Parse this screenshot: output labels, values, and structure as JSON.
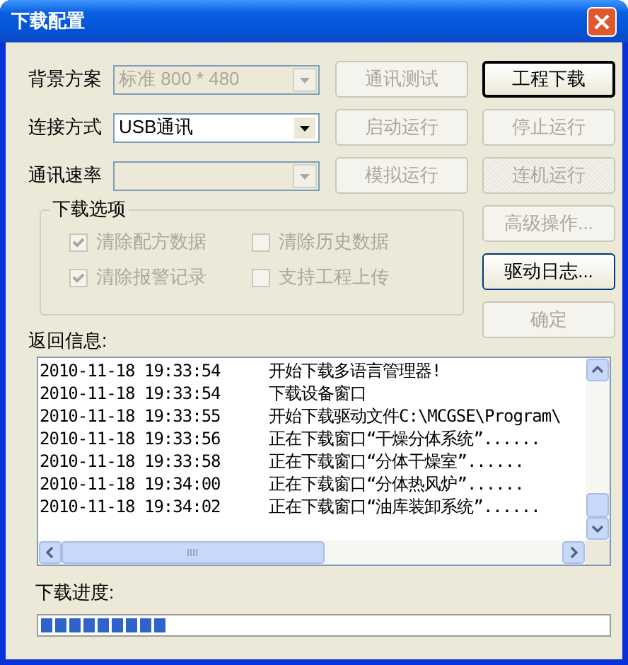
{
  "window": {
    "title": "下载配置"
  },
  "settings": [
    {
      "label": "背景方案",
      "value": "标准 800 * 480",
      "disabled": true
    },
    {
      "label": "连接方式",
      "value": "USB通讯",
      "disabled": false
    },
    {
      "label": "通讯速率",
      "disabled": true
    }
  ],
  "middle_buttons": [
    {
      "label": "通讯测试",
      "disabled": true
    },
    {
      "label": "启动运行",
      "disabled": true
    },
    {
      "label": "模拟运行",
      "disabled": true
    }
  ],
  "right_buttons": [
    {
      "label": "工程下载",
      "disabled": false,
      "default": true,
      "pressed": false
    },
    {
      "label": "停止运行",
      "disabled": true,
      "default": false,
      "pressed": false
    },
    {
      "label": "连机运行",
      "disabled": true,
      "default": false,
      "pressed": true
    },
    {
      "label": "高级操作...",
      "disabled": true,
      "default": false,
      "pressed": false
    },
    {
      "label": "驱动日志...",
      "disabled": false,
      "default": false,
      "pressed": false
    },
    {
      "label": "确定",
      "disabled": true,
      "default": false,
      "pressed": false
    }
  ],
  "download_options": {
    "title": "下载选项",
    "options": [
      {
        "label": "清除配方数据",
        "checked": true,
        "disabled": true
      },
      {
        "label": "清除历史数据",
        "checked": false,
        "disabled": true
      },
      {
        "label": "清除报警记录",
        "checked": true,
        "disabled": true
      },
      {
        "label": "支持工程上传",
        "checked": false,
        "disabled": true
      }
    ]
  },
  "log": {
    "label": "返回信息:",
    "rows": [
      {
        "time": "2010-11-18 19:33:54",
        "message": "开始下载多语言管理器!"
      },
      {
        "time": "2010-11-18 19:33:54",
        "message": "下载设备窗口"
      },
      {
        "time": "2010-11-18 19:33:55",
        "message": "开始下载驱动文件C:\\MCGSE\\Program\\"
      },
      {
        "time": "2010-11-18 19:33:56",
        "message": "正在下载窗口“干燥分体系统”......"
      },
      {
        "time": "2010-11-18 19:33:58",
        "message": "正在下载窗口“分体干燥室”......"
      },
      {
        "time": "2010-11-18 19:34:00",
        "message": "正在下载窗口“分体热风炉”......"
      },
      {
        "time": "2010-11-18 19:34:02",
        "message": "正在下载窗口“油库装卸系统”......"
      }
    ]
  },
  "progress": {
    "label": "下载进度:",
    "level": 0.22
  }
}
